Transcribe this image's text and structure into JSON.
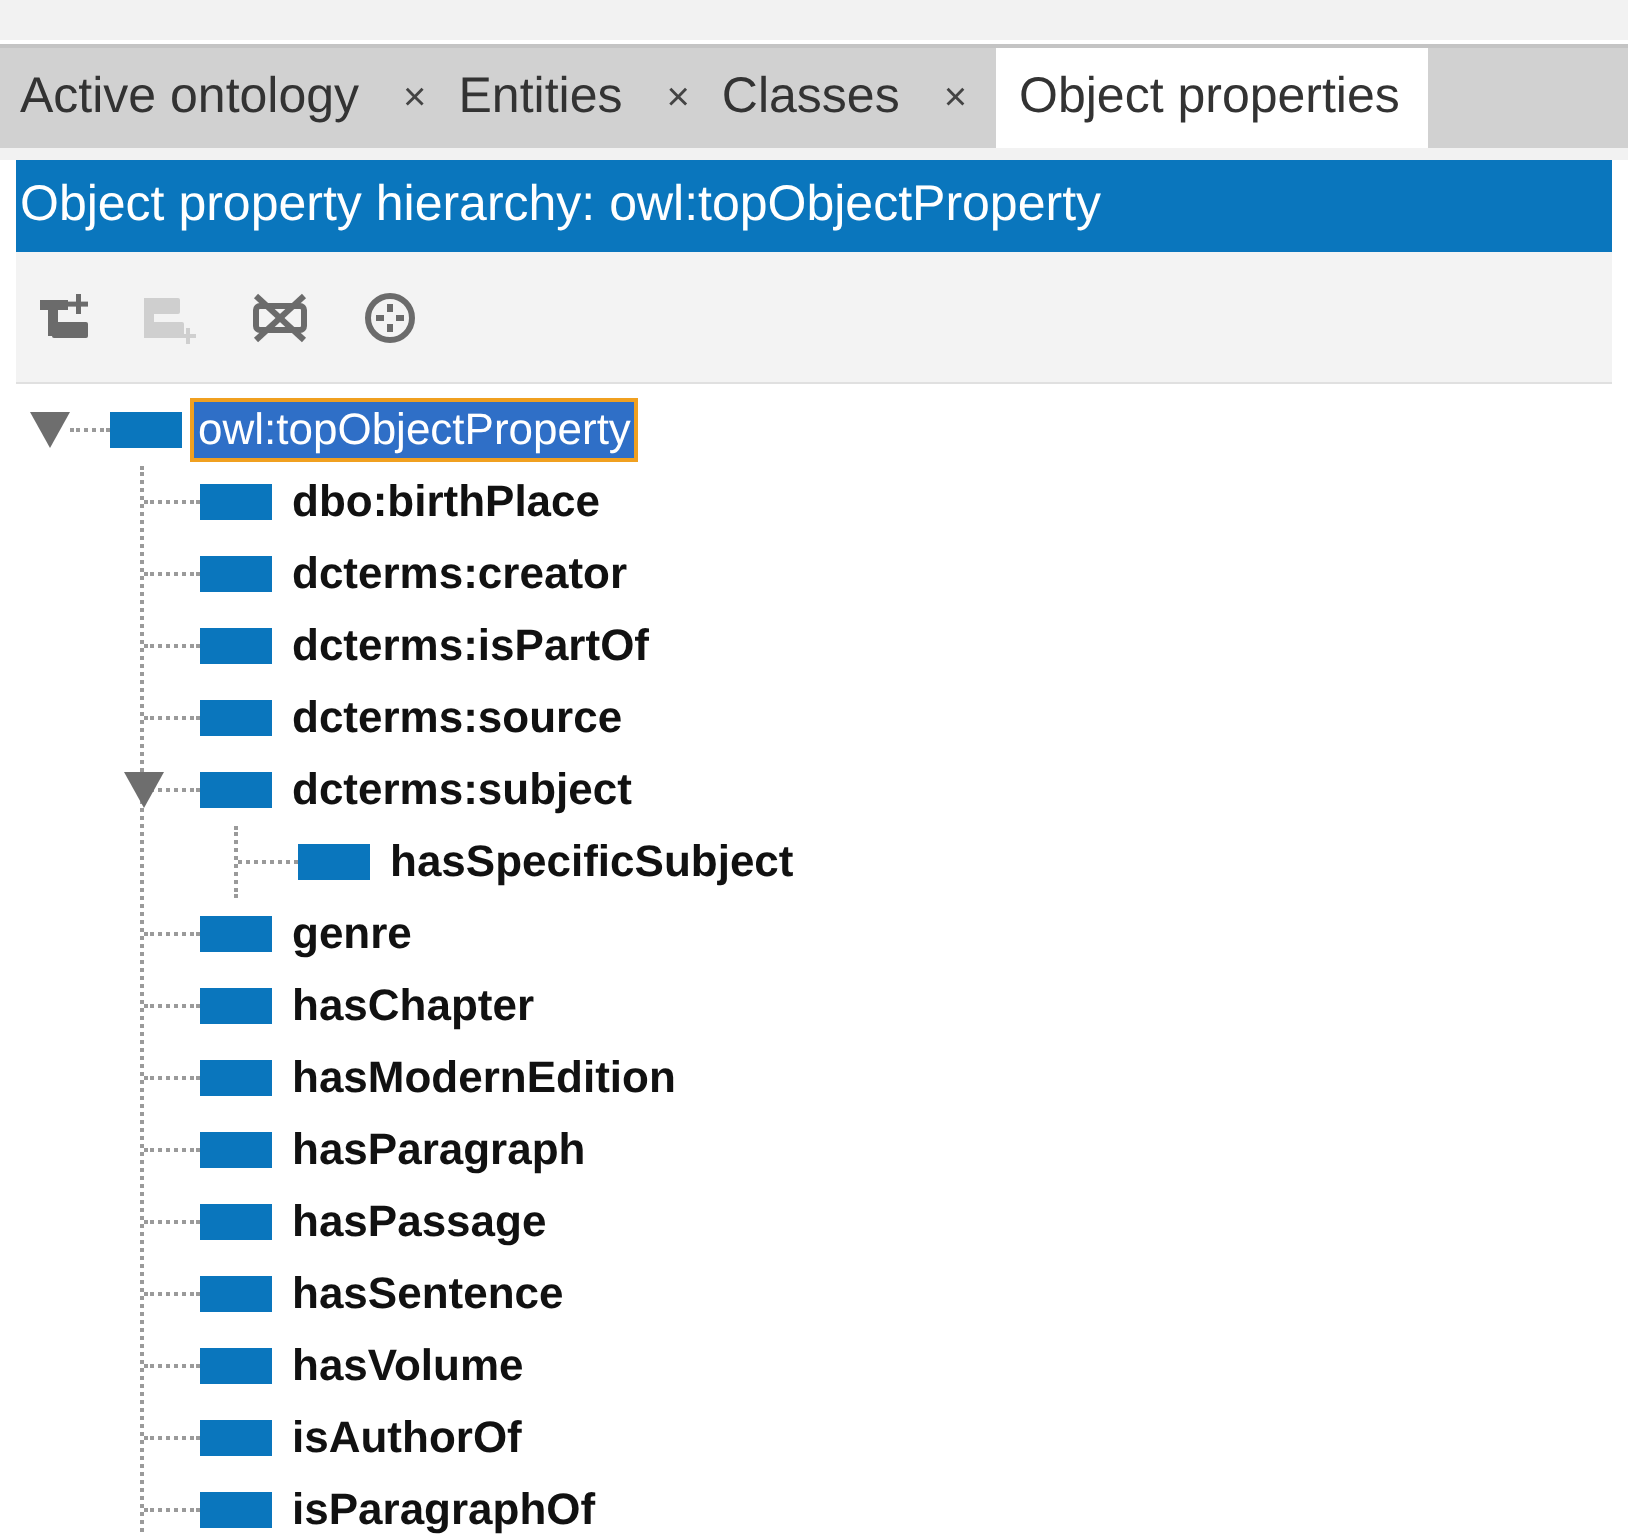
{
  "tabs": [
    {
      "label": "Active ontology",
      "close": "×",
      "selected": false
    },
    {
      "label": "Entities",
      "close": "×",
      "selected": false
    },
    {
      "label": "Classes",
      "close": "×",
      "selected": false
    },
    {
      "label": "Object properties",
      "selected": true
    }
  ],
  "panel": {
    "title": "Object property hierarchy: owl:topObjectProperty"
  },
  "toolbar": [
    {
      "kind": "add-sub",
      "disabled": false
    },
    {
      "kind": "add-sibling",
      "disabled": true
    },
    {
      "kind": "delete",
      "disabled": false
    },
    {
      "kind": "target",
      "disabled": false
    }
  ],
  "tree": [
    {
      "label": "owl:topObjectProperty",
      "selected": true,
      "expanded": true,
      "children": [
        {
          "label": "dbo:birthPlace",
          "selected": false
        },
        {
          "label": "dcterms:creator",
          "selected": false
        },
        {
          "label": "dcterms:isPartOf",
          "selected": false
        },
        {
          "label": "dcterms:source",
          "selected": false
        },
        {
          "label": "dcterms:subject",
          "selected": false,
          "expanded": true,
          "children": [
            {
              "label": "hasSpecificSubject",
              "selected": false
            }
          ]
        },
        {
          "label": "genre",
          "selected": false
        },
        {
          "label": "hasChapter",
          "selected": false
        },
        {
          "label": "hasModernEdition",
          "selected": false
        },
        {
          "label": "hasParagraph",
          "selected": false
        },
        {
          "label": "hasPassage",
          "selected": false
        },
        {
          "label": "hasSentence",
          "selected": false
        },
        {
          "label": "hasVolume",
          "selected": false
        },
        {
          "label": "isAuthorOf",
          "selected": false
        },
        {
          "label": "isParagraphOf",
          "selected": false
        }
      ]
    }
  ]
}
